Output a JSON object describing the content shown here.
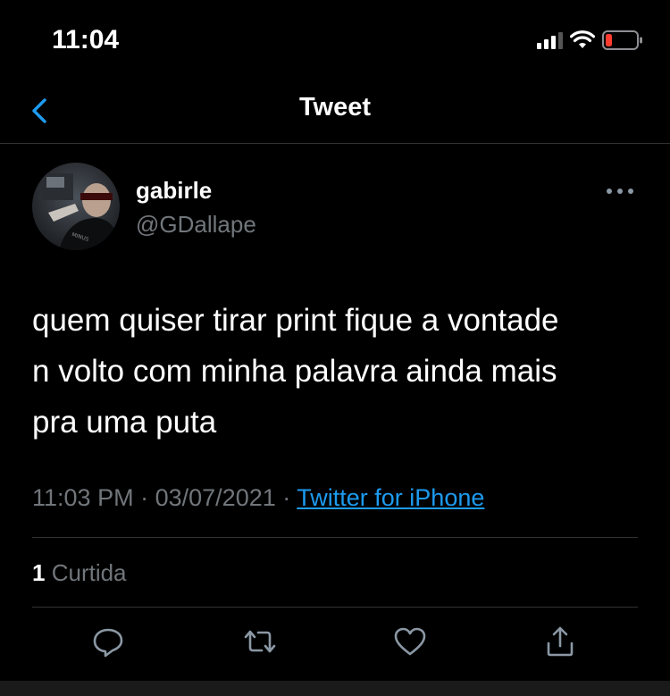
{
  "status_bar": {
    "time": "11:04",
    "icons": [
      "cellular-signal-icon",
      "wifi-icon",
      "battery-low-icon"
    ],
    "battery_color": "#ff3b30"
  },
  "nav": {
    "title": "Tweet",
    "back_icon": "chevron-left-icon",
    "accent_color": "#1d9bf0"
  },
  "tweet": {
    "display_name": "gabirle",
    "handle": "@GDallape",
    "text": "quem quiser tirar print fique a vontade\nn volto com minha palavra ainda mais\npra uma puta",
    "time": "11:03 PM",
    "separator": "·",
    "date": "03/07/2021",
    "source": "Twitter for iPhone",
    "like_count": "1",
    "like_label": "Curtida"
  },
  "actions": [
    "reply-icon",
    "retweet-icon",
    "like-icon",
    "share-icon"
  ]
}
